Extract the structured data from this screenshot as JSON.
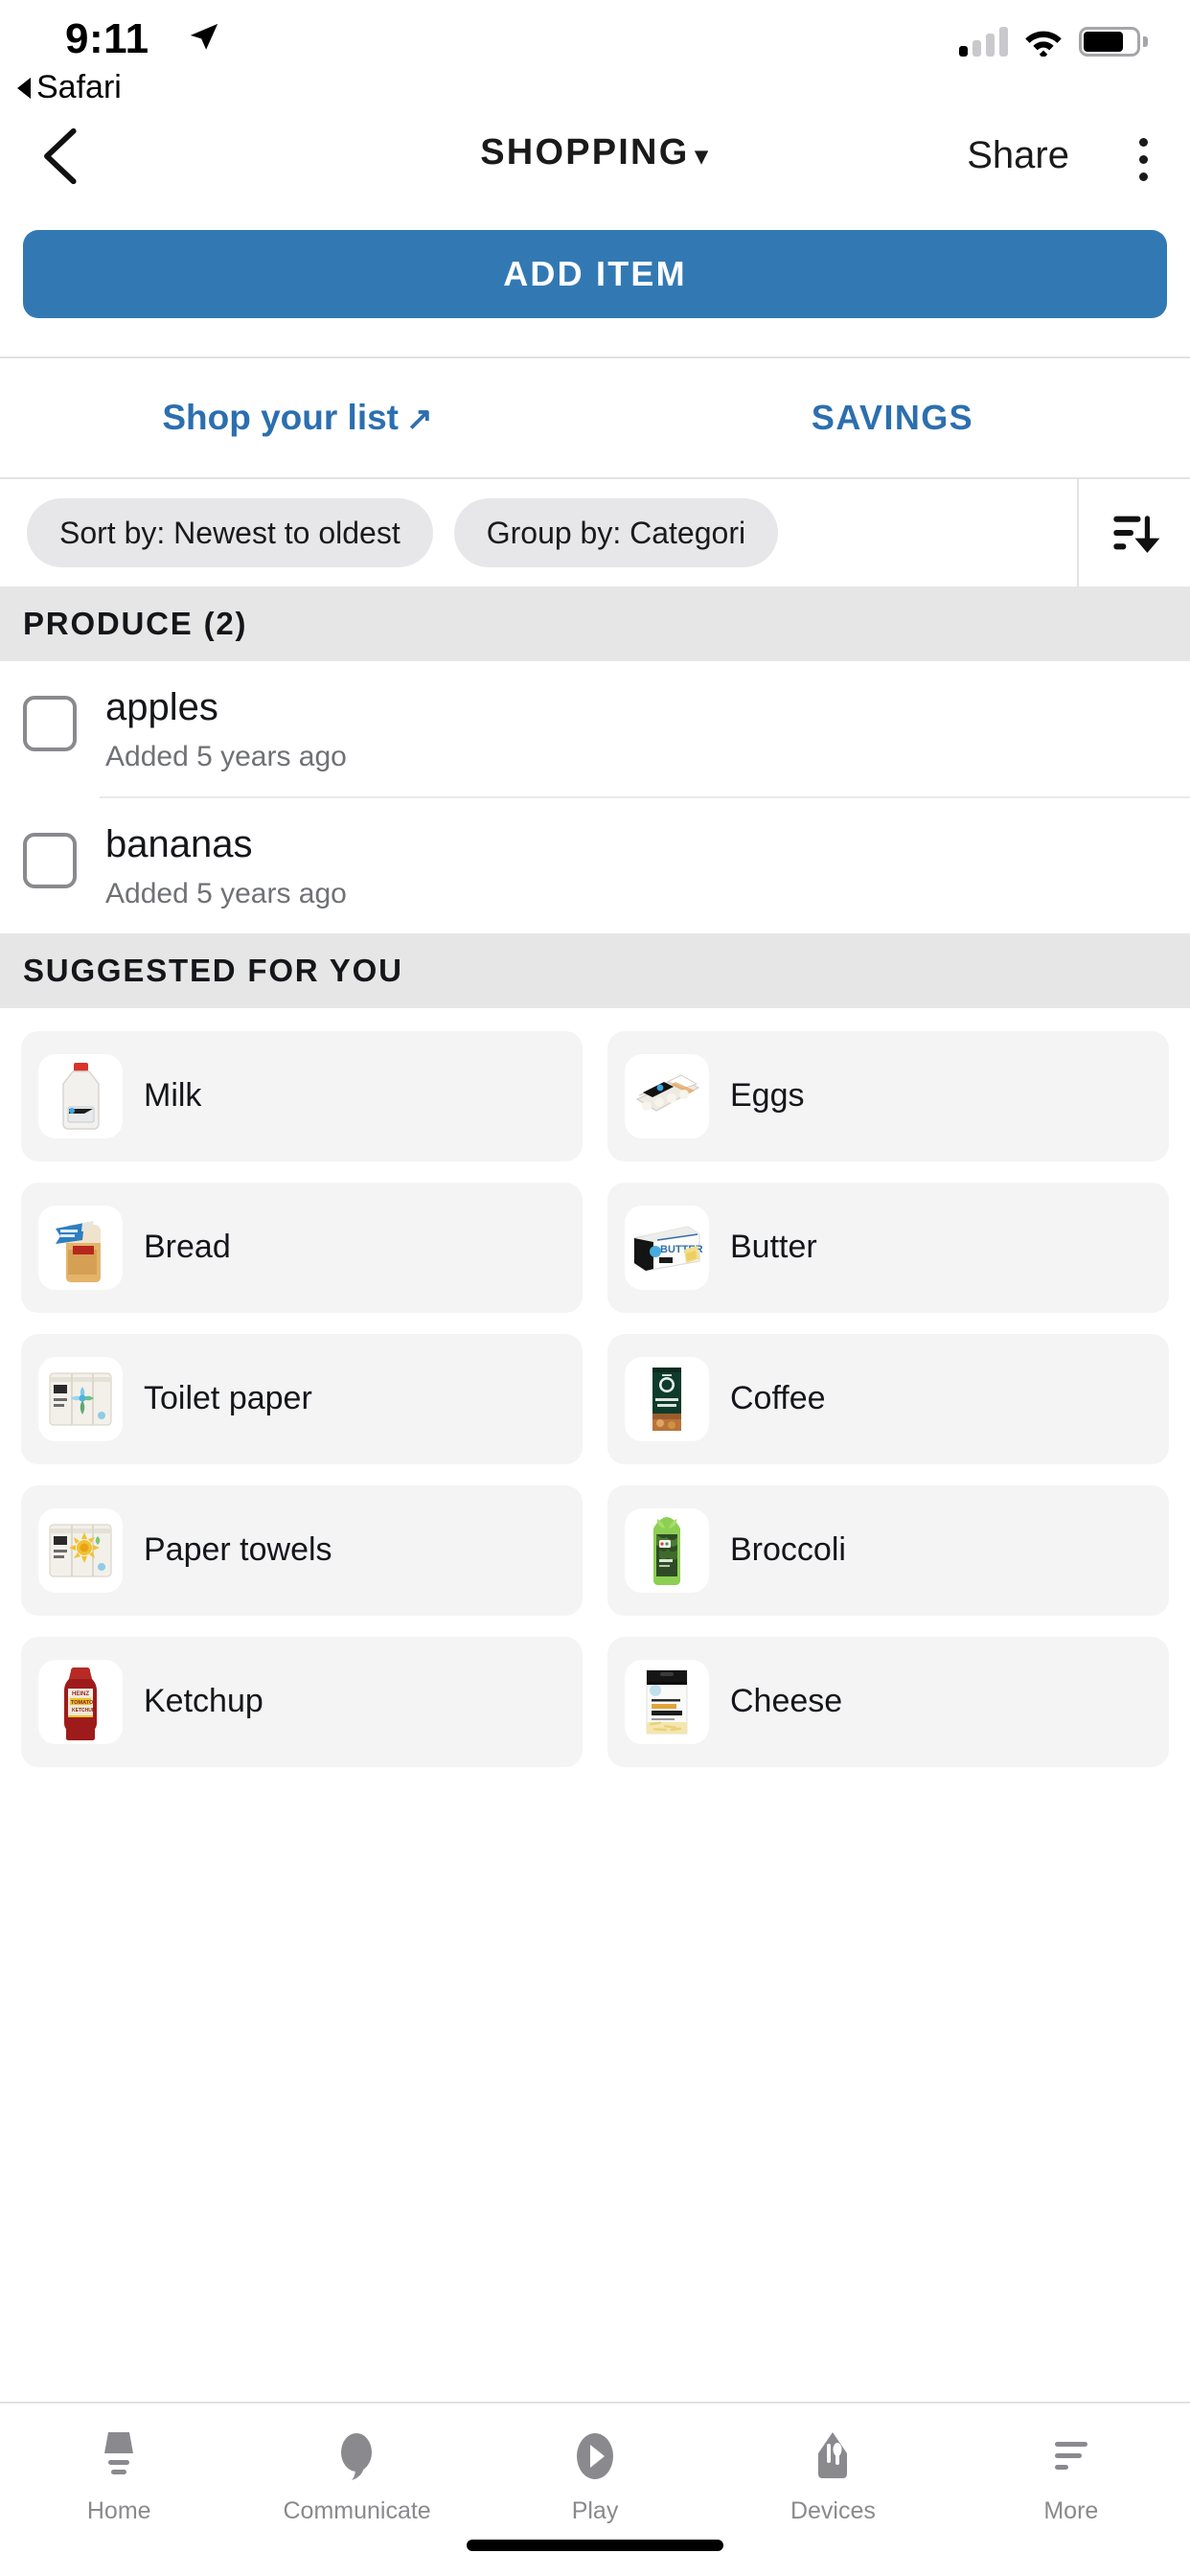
{
  "status_bar": {
    "time": "9:11",
    "location_icon": "location-arrow-icon",
    "back_app_label": "Safari",
    "signal_icon": "cellular-signal-icon",
    "wifi_icon": "wifi-icon",
    "battery_icon": "battery-icon"
  },
  "nav": {
    "back_icon": "chevron-left-icon",
    "title": "SHOPPING",
    "title_caret": "▾",
    "share_label": "Share",
    "overflow_icon": "kebab-menu-icon"
  },
  "toolbar": {
    "add_item_label": "ADD ITEM",
    "add_item_color": "#3279B4"
  },
  "links": {
    "shop_label": "Shop your list",
    "shop_arrow": "↗",
    "savings_label": "SAVINGS",
    "link_color": "#2C6FAF"
  },
  "filters": {
    "sort_chip": "Sort by: Newest to oldest",
    "group_chip": "Group by: Categori",
    "sort_icon": "sort-descending-icon"
  },
  "sections": [
    {
      "title": "PRODUCE (2)",
      "items": [
        {
          "name": "apples",
          "subtitle": "Added 5 years ago",
          "checked": false
        },
        {
          "name": "bananas",
          "subtitle": "Added 5 years ago",
          "checked": false
        }
      ]
    }
  ],
  "suggested": {
    "title": "SUGGESTED FOR YOU",
    "items": [
      {
        "label": "Milk",
        "icon": "milk-jug-icon"
      },
      {
        "label": "Eggs",
        "icon": "egg-carton-icon"
      },
      {
        "label": "Bread",
        "icon": "bread-loaf-icon"
      },
      {
        "label": "Butter",
        "icon": "butter-box-icon"
      },
      {
        "label": "Toilet paper",
        "icon": "toilet-paper-pack-icon"
      },
      {
        "label": "Coffee",
        "icon": "coffee-bag-icon"
      },
      {
        "label": "Paper towels",
        "icon": "paper-towels-pack-icon"
      },
      {
        "label": "Broccoli",
        "icon": "broccoli-bag-icon"
      },
      {
        "label": "Ketchup",
        "icon": "ketchup-bottle-icon"
      },
      {
        "label": "Cheese",
        "icon": "cheese-bag-icon"
      }
    ]
  },
  "tabbar": {
    "items": [
      {
        "label": "Home",
        "icon": "home-lamp-icon"
      },
      {
        "label": "Communicate",
        "icon": "speech-bubble-icon"
      },
      {
        "label": "Play",
        "icon": "play-circle-icon"
      },
      {
        "label": "Devices",
        "icon": "devices-leaf-icon"
      },
      {
        "label": "More",
        "icon": "more-lines-icon"
      }
    ]
  }
}
